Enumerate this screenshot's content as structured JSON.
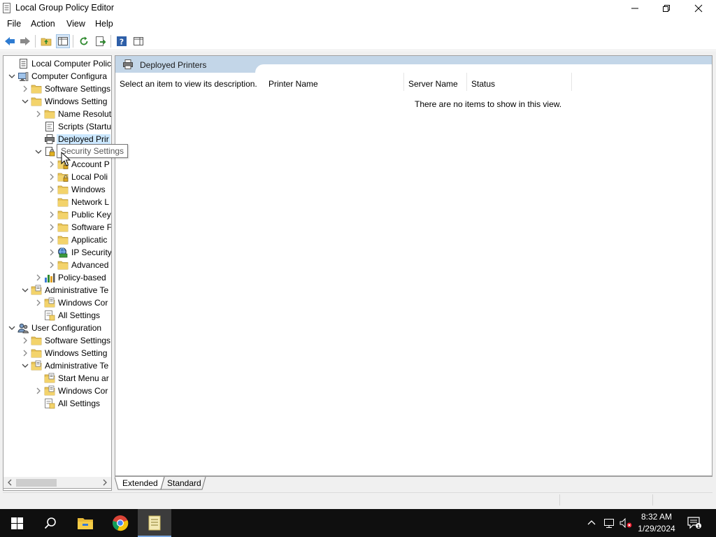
{
  "window": {
    "title": "Local Group Policy Editor"
  },
  "menu": {
    "file": "File",
    "action": "Action",
    "view": "View",
    "help": "Help"
  },
  "tree": {
    "nodes": [
      {
        "label": "Local Computer Policy",
        "icon": "policy-doc-icon"
      },
      {
        "label": "Computer Configura",
        "icon": "computer-icon"
      },
      {
        "label": "Software Settings",
        "icon": "folder-icon"
      },
      {
        "label": "Windows Setting",
        "icon": "folder-icon"
      },
      {
        "label": "Name Resolut",
        "icon": "folder-icon"
      },
      {
        "label": "Scripts (Startu",
        "icon": "scripts-icon"
      },
      {
        "label": "Deployed Prir",
        "icon": "printer-icon"
      },
      {
        "label": "Security Settings",
        "icon": "security-icon"
      },
      {
        "label": "Account P",
        "icon": "folder-lock-icon"
      },
      {
        "label": "Local Poli",
        "icon": "folder-lock-icon"
      },
      {
        "label": "Windows",
        "icon": "folder-icon"
      },
      {
        "label": "Network L",
        "icon": "folder-icon"
      },
      {
        "label": "Public Key",
        "icon": "folder-icon"
      },
      {
        "label": "Software F",
        "icon": "folder-icon"
      },
      {
        "label": "Applicatic",
        "icon": "folder-icon"
      },
      {
        "label": "IP Security",
        "icon": "ip-security-icon"
      },
      {
        "label": "Advanced",
        "icon": "folder-icon"
      },
      {
        "label": "Policy-based",
        "icon": "bar-chart-icon"
      },
      {
        "label": "Administrative Te",
        "icon": "admin-folder-icon"
      },
      {
        "label": "Windows Cor",
        "icon": "admin-folder-icon"
      },
      {
        "label": "All Settings",
        "icon": "all-settings-icon"
      },
      {
        "label": "User Configuration",
        "icon": "users-icon"
      },
      {
        "label": "Software Settings",
        "icon": "folder-icon"
      },
      {
        "label": "Windows Setting",
        "icon": "folder-icon"
      },
      {
        "label": "Administrative Te",
        "icon": "admin-folder-icon"
      },
      {
        "label": "Start Menu ar",
        "icon": "admin-folder-icon"
      },
      {
        "label": "Windows Cor",
        "icon": "admin-folder-icon"
      },
      {
        "label": "All Settings",
        "icon": "all-settings-icon"
      }
    ],
    "tooltip": "Security Settings"
  },
  "pane": {
    "title": "Deployed Printers",
    "description": "Select an item to view its description.",
    "columns": [
      "Printer Name",
      "Server Name",
      "Status"
    ],
    "empty_message": "There are no items to show in this view."
  },
  "tabs": {
    "extended": "Extended",
    "standard": "Standard"
  },
  "taskbar": {
    "time": "8:32 AM",
    "date": "1/29/2024",
    "notification_count": "1"
  },
  "colors": {
    "selection": "#cce8ff",
    "pane_header": "#c3d6e8",
    "folder": "#e8c45a",
    "taskbar": "#0f0f0f"
  }
}
